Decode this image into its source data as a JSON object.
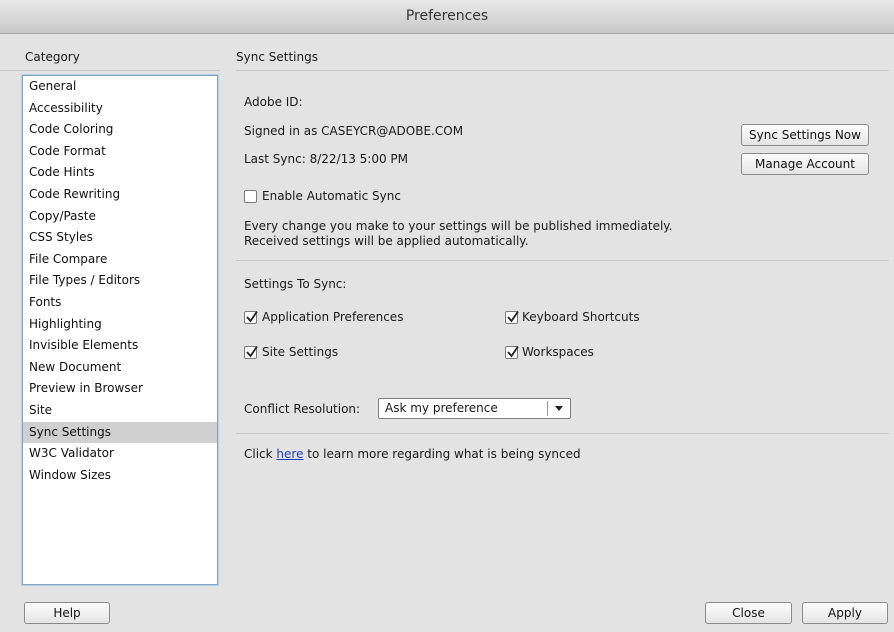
{
  "window": {
    "title": "Preferences"
  },
  "category": {
    "header": "Category",
    "items": [
      "General",
      "Accessibility",
      "Code Coloring",
      "Code Format",
      "Code Hints",
      "Code Rewriting",
      "Copy/Paste",
      "CSS Styles",
      "File Compare",
      "File Types / Editors",
      "Fonts",
      "Highlighting",
      "Invisible Elements",
      "New Document",
      "Preview in Browser",
      "Site",
      "Sync Settings",
      "W3C Validator",
      "Window Sizes"
    ],
    "selected": "Sync Settings"
  },
  "sync": {
    "header": "Sync Settings",
    "adobe_id_label": "Adobe ID:",
    "signed_in": "Signed in as CASEYCR@ADOBE.COM",
    "last_sync": "Last Sync: 8/22/13 5:00 PM",
    "sync_now_button": "Sync Settings Now",
    "manage_account_button": "Manage Account",
    "auto_sync_label": "Enable Automatic Sync",
    "auto_sync_checked": false,
    "desc_line1": "Every change you make to your settings will be published immediately.",
    "desc_line2": "Received settings will be applied automatically.",
    "settings_to_sync_label": "Settings To Sync:",
    "options": {
      "app_prefs": {
        "label": "Application Preferences",
        "checked": true
      },
      "keyboard": {
        "label": "Keyboard Shortcuts",
        "checked": true
      },
      "site": {
        "label": "Site Settings",
        "checked": true
      },
      "workspaces": {
        "label": "Workspaces",
        "checked": true
      }
    },
    "conflict_label": "Conflict Resolution:",
    "conflict_value": "Ask my preference",
    "info_prefix": "Click",
    "info_link": "here",
    "info_suffix": "to learn more regarding what is being synced"
  },
  "footer": {
    "help": "Help",
    "close": "Close",
    "apply": "Apply"
  }
}
